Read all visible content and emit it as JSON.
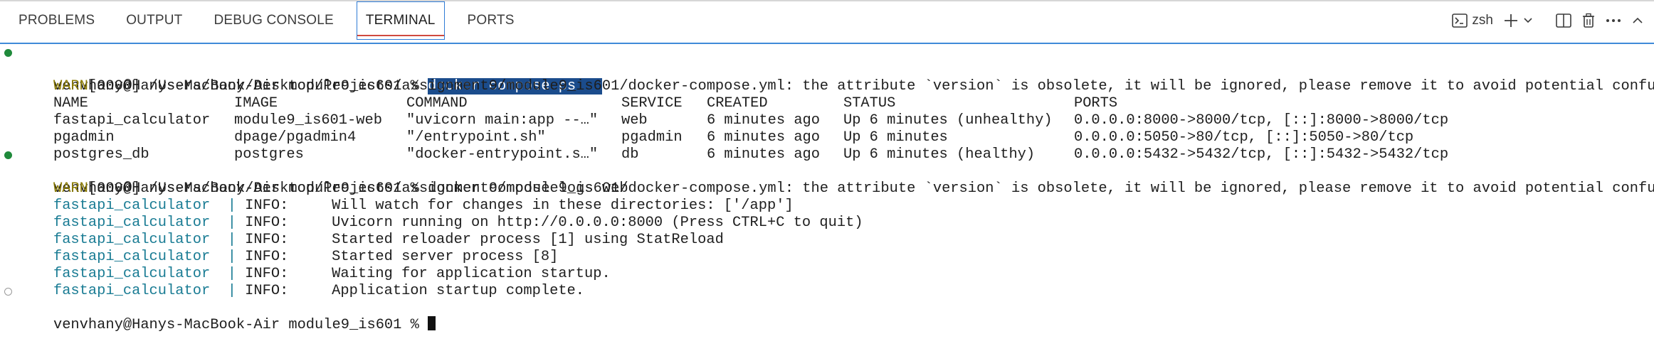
{
  "panel": {
    "tabs": [
      "PROBLEMS",
      "OUTPUT",
      "DEBUG CONSOLE",
      "TERMINAL",
      "PORTS"
    ],
    "active_tab": "TERMINAL",
    "shell_name": "zsh"
  },
  "terminal": {
    "prompt1": "venvhany@Hanys-MacBook-Air module9_is601 % ",
    "cmd1": "docker compose ps   ",
    "warn_tag": "WARN",
    "warn_rest": "[0000] /Users/hany/Desktop/Projects/assignment9/module9_is601/docker-compose.yml: the attribute `version` is obsolete, it will be ignored, please remove it to avoid potential confusion",
    "table": {
      "headers": [
        "NAME",
        "IMAGE",
        "COMMAND",
        "SERVICE",
        "CREATED",
        "STATUS",
        "PORTS"
      ],
      "rows": [
        [
          "fastapi_calculator",
          "module9_is601-web",
          "\"uvicorn main:app --…\"",
          "web",
          "6 minutes ago",
          "Up 6 minutes (unhealthy)",
          "0.0.0.0:8000->8000/tcp, [::]:8000->8000/tcp"
        ],
        [
          "pgadmin",
          "dpage/pgadmin4",
          "\"/entrypoint.sh\"",
          "pgadmin",
          "6 minutes ago",
          "Up 6 minutes",
          "0.0.0.0:5050->80/tcp, [::]:5050->80/tcp"
        ],
        [
          "postgres_db",
          "postgres",
          "\"docker-entrypoint.s…\"",
          "db",
          "6 minutes ago",
          "Up 6 minutes (healthy)",
          "0.0.0.0:5432->5432/tcp, [::]:5432->5432/tcp"
        ]
      ]
    },
    "prompt2": "venvhany@Hanys-MacBook-Air module9_is601 % ",
    "cmd2": "docker compose logs web",
    "logs": [
      {
        "src": "fastapi_calculator",
        "sep": "  | ",
        "level": "INFO:",
        "msg": "Will watch for changes in these directories: ['/app']"
      },
      {
        "src": "fastapi_calculator",
        "sep": "  | ",
        "level": "INFO:",
        "msg": "Uvicorn running on http://0.0.0.0:8000 (Press CTRL+C to quit)"
      },
      {
        "src": "fastapi_calculator",
        "sep": "  | ",
        "level": "INFO:",
        "msg": "Started reloader process [1] using StatReload"
      },
      {
        "src": "fastapi_calculator",
        "sep": "  | ",
        "level": "INFO:",
        "msg": "Started server process [8]"
      },
      {
        "src": "fastapi_calculator",
        "sep": "  | ",
        "level": "INFO:",
        "msg": "Waiting for application startup."
      },
      {
        "src": "fastapi_calculator",
        "sep": "  | ",
        "level": "INFO:",
        "msg": "Application startup complete."
      }
    ],
    "prompt3": "venvhany@Hanys-MacBook-Air module9_is601 % "
  }
}
